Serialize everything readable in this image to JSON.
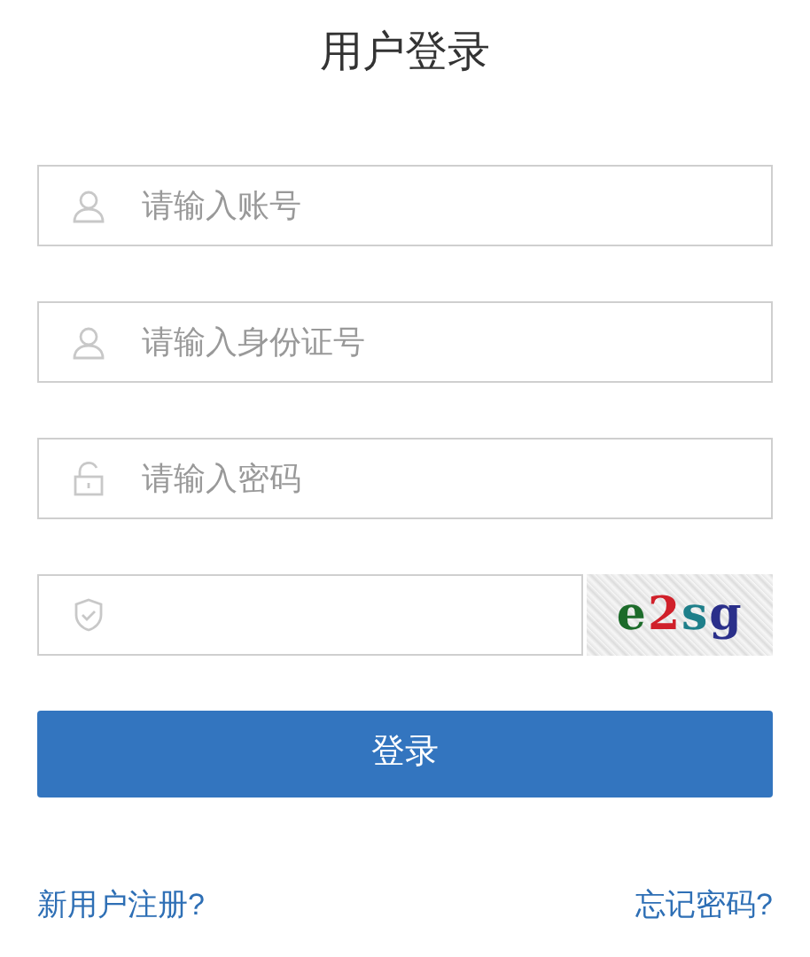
{
  "title": "用户登录",
  "fields": [
    {
      "kind": "user",
      "placeholder": "请输入账号"
    },
    {
      "kind": "user",
      "placeholder": "请输入身份证号"
    },
    {
      "kind": "lock",
      "placeholder": "请输入密码"
    }
  ],
  "captcha": {
    "code": "e2sg"
  },
  "login_button": "登录",
  "links": [
    "新用户注册?",
    "忘记密码?"
  ]
}
